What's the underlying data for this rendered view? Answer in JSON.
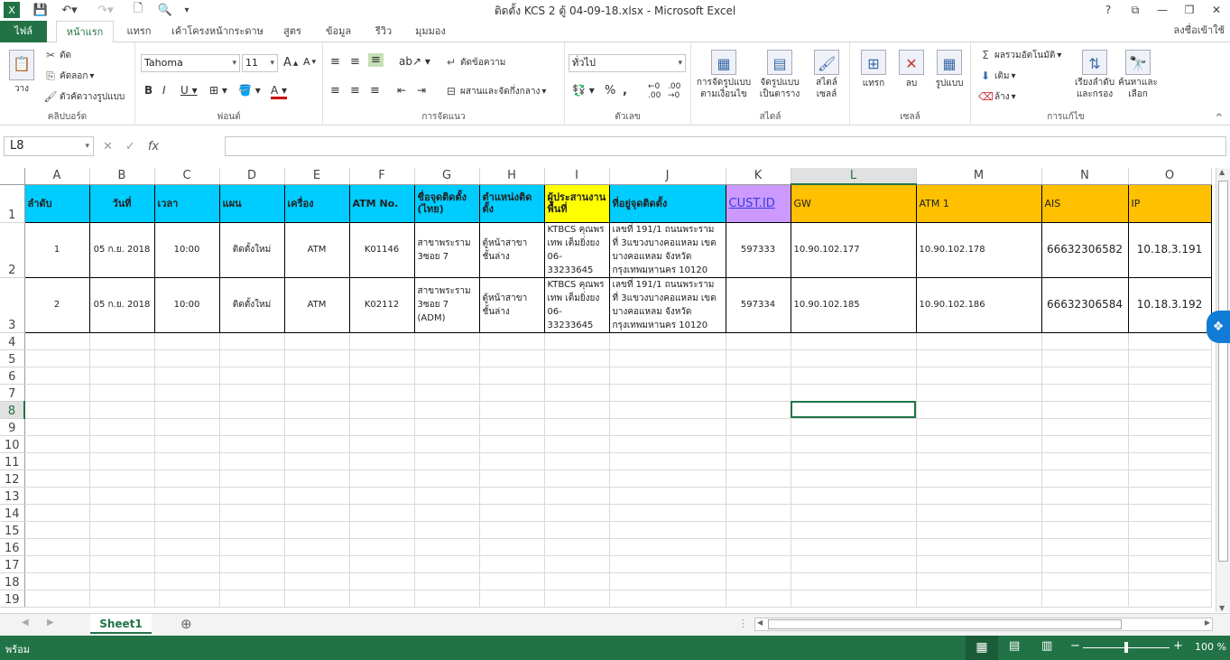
{
  "window": {
    "title": "ติดตั้ง KCS 2 ตู้ 04-09-18.xlsx - Microsoft Excel",
    "help": "?",
    "restore": "⧉",
    "min": "—",
    "max": "❐",
    "close": "✕"
  },
  "tabs": {
    "file": "ไฟล์",
    "items": [
      "หน้าแรก",
      "แทรก",
      "เค้าโครงหน้ากระดาษ",
      "สูตร",
      "ข้อมูล",
      "รีวิว",
      "มุมมอง"
    ],
    "signin": "ลงชื่อเข้าใช้"
  },
  "ribbon": {
    "clipboard": {
      "label": "คลิปบอร์ด",
      "paste": "วาง",
      "cut": "ตัด",
      "copy": "คัดลอก",
      "painter": "ตัวคัดวางรูปแบบ"
    },
    "font": {
      "label": "ฟอนต์",
      "name": "Tahoma",
      "size": "11"
    },
    "alignment": {
      "label": "การจัดแนว",
      "wrap": "ตัดข้อความ",
      "merge": "ผสานและจัดกึ่งกลาง"
    },
    "number": {
      "label": "ตัวเลข",
      "format": "ทั่วไป"
    },
    "styles": {
      "label": "สไตล์",
      "cond": "การจัดรูปแบบตามเงื่อนไข",
      "table": "จัดรูปแบบเป็นตาราง",
      "cell": "สไตล์เซลล์"
    },
    "cells": {
      "label": "เซลล์",
      "insert": "แทรก",
      "delete": "ลบ",
      "format": "รูปแบบ"
    },
    "editing": {
      "label": "การแก้ไข",
      "autosum": "ผลรวมอัตโนมัติ",
      "fill": "เติม",
      "clear": "ล้าง",
      "sort": "เรียงลำดับและกรอง",
      "find": "ค้นหาและเลือก"
    }
  },
  "formula": {
    "namebox": "L8",
    "fx": "fx",
    "value": ""
  },
  "columns": [
    "A",
    "B",
    "C",
    "D",
    "E",
    "F",
    "G",
    "H",
    "I",
    "J",
    "K",
    "L",
    "M",
    "N",
    "O"
  ],
  "selected_col": "L",
  "selected_row": 8,
  "header_row": [
    "ลำดับ",
    "วันที่",
    "เวลา",
    "แผน",
    "เครื่อง",
    "ATM No.",
    "ชื่อจุดติดตั้ง (ไทย)",
    "ตำแหน่งติดตั้ง",
    "ผู้ประสานงานพื้นที่",
    "ที่อยู่จุดติดตั้ง",
    "CUST.ID",
    "GW",
    "ATM 1",
    "AIS",
    "IP"
  ],
  "rows": [
    [
      "1",
      "05 ก.ย. 2018",
      "10:00",
      "ติดตั้งใหม่",
      "ATM",
      "K01146",
      "สาขาพระราม 3ซอย 7",
      "ตู้หน้าสาขา ชั้นล่าง",
      "KTBCS คุณพรเทพ เต็มยิ่งยง 06-33233645",
      "เลขที่ 191/1 ถนนพระราม ที่ 3แขวงบางคอแหลม เขตบางคอแหลม จังหวัดกรุงเทพมหานคร 10120",
      "597333",
      "10.90.102.177",
      "10.90.102.178",
      "66632306582",
      "10.18.3.191"
    ],
    [
      "2",
      "05 ก.ย. 2018",
      "10:00",
      "ติดตั้งใหม่",
      "ATM",
      "K02112",
      "สาขาพระราม 3ซอย 7 (ADM)",
      "ตู้หน้าสาขา ชั้นล่าง",
      "KTBCS คุณพรเทพ เต็มยิ่งยง 06-33233645",
      "เลขที่ 191/1 ถนนพระราม ที่ 3แขวงบางคอแหลม เขตบางคอแหลม จังหวัดกรุงเทพมหานคร 10120",
      "597334",
      "10.90.102.185",
      "10.90.102.186",
      "66632306584",
      "10.18.3.192"
    ]
  ],
  "empty_rows": [
    "4",
    "5",
    "6",
    "7",
    "8",
    "9",
    "10",
    "11",
    "12",
    "13",
    "14",
    "15",
    "16",
    "17",
    "18",
    "19"
  ],
  "sheet": {
    "name": "Sheet1",
    "add": "⊕"
  },
  "status": {
    "ready": "พร้อม",
    "zoom": "100 %"
  },
  "colors": {
    "accent": "#217346",
    "header_cyan": "#00ccff",
    "header_yellow": "#ffff00",
    "header_purple": "#cc99ff",
    "header_orange": "#ffc000"
  }
}
